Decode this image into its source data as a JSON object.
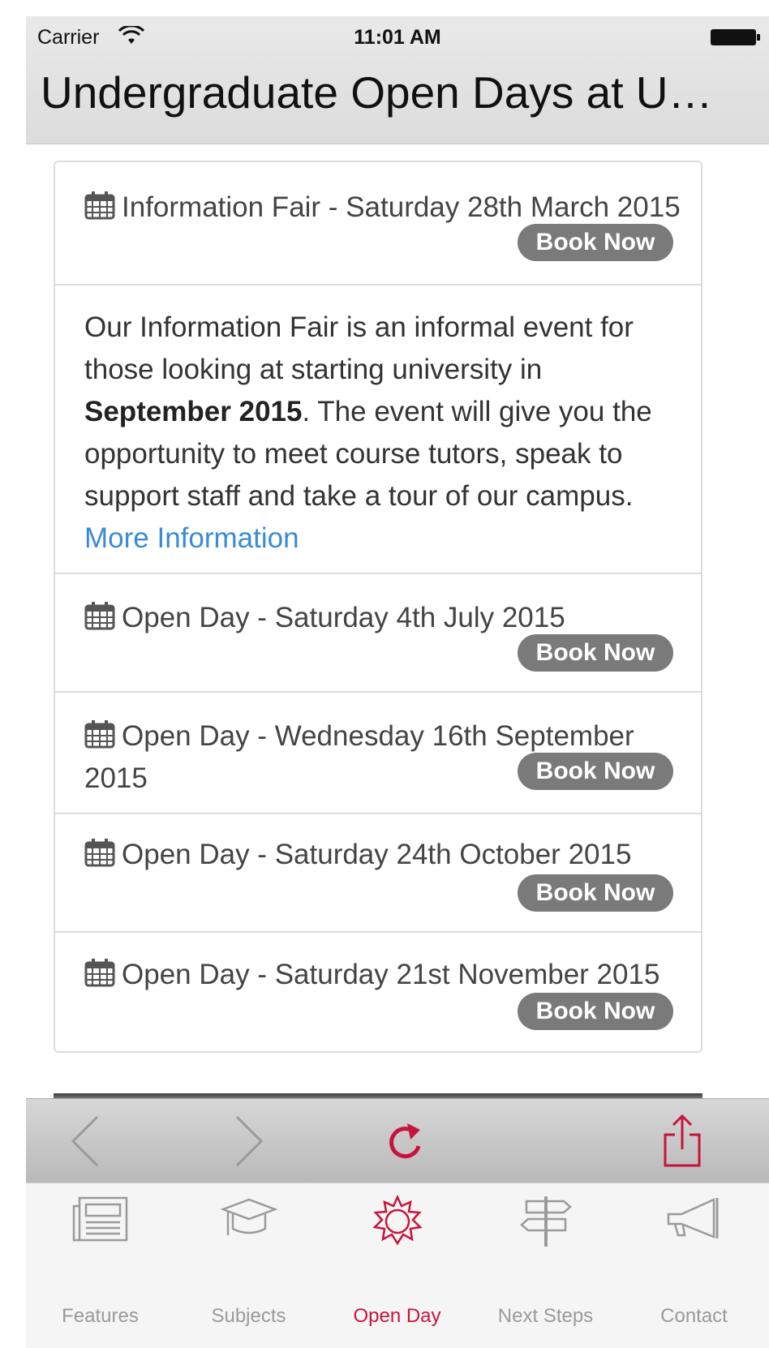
{
  "status_bar": {
    "carrier": "Carrier",
    "time": "11:01 AM"
  },
  "header": {
    "title": "Undergraduate Open Days at U…"
  },
  "events": [
    {
      "title": "Information Fair - Saturday 28th March 2015",
      "button": "Book Now"
    },
    {
      "title": "Open Day - Saturday 4th July 2015",
      "button": "Book Now"
    },
    {
      "title": "Open Day - Wednesday 16th September 2015",
      "button": "Book Now"
    },
    {
      "title": "Open Day - Saturday 24th October 2015",
      "button": "Book Now"
    },
    {
      "title": "Open Day - Saturday 21st November 2015",
      "button": "Book Now"
    }
  ],
  "description": {
    "part1": "Our Information Fair is an informal event for those looking at starting university in ",
    "bold": "September 2015",
    "part2": ". The event will give you the opportunity to meet course tutors, speak to support staff and take a tour of our campus. ",
    "link": "More Information"
  },
  "toolbar": {
    "icons": [
      "back-icon",
      "forward-icon",
      "reload-icon",
      "share-icon"
    ],
    "accent_color": "#c7143c"
  },
  "tabs": [
    {
      "label": "Features",
      "icon": "newspaper-icon",
      "active": false
    },
    {
      "label": "Subjects",
      "icon": "graduation-cap-icon",
      "active": false
    },
    {
      "label": "Open Day",
      "icon": "sun-icon",
      "active": true
    },
    {
      "label": "Next Steps",
      "icon": "signpost-icon",
      "active": false
    },
    {
      "label": "Contact",
      "icon": "megaphone-icon",
      "active": false
    }
  ],
  "colors": {
    "button_bg": "#7a7a7a",
    "link": "#3a8ad6",
    "active_tab": "#c7143c"
  }
}
